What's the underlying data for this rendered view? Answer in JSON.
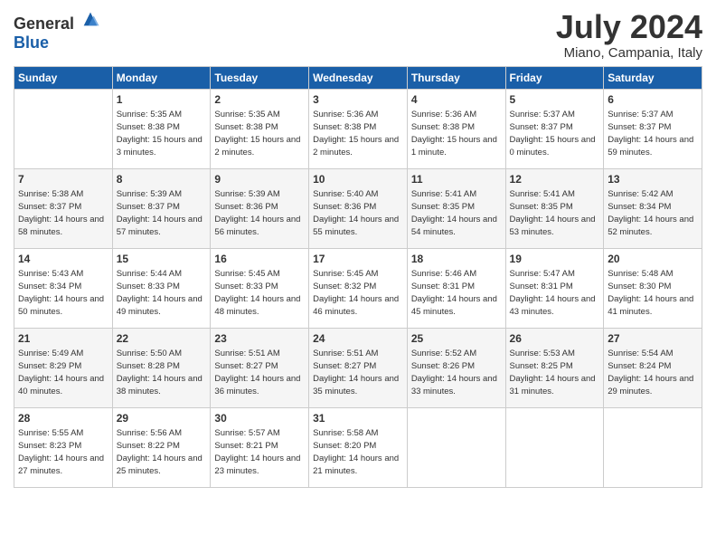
{
  "header": {
    "logo_general": "General",
    "logo_blue": "Blue",
    "title": "July 2024",
    "subtitle": "Miano, Campania, Italy"
  },
  "weekdays": [
    "Sunday",
    "Monday",
    "Tuesday",
    "Wednesday",
    "Thursday",
    "Friday",
    "Saturday"
  ],
  "weeks": [
    [
      {
        "day": "",
        "sunrise": "",
        "sunset": "",
        "daylight": ""
      },
      {
        "day": "1",
        "sunrise": "Sunrise: 5:35 AM",
        "sunset": "Sunset: 8:38 PM",
        "daylight": "Daylight: 15 hours and 3 minutes."
      },
      {
        "day": "2",
        "sunrise": "Sunrise: 5:35 AM",
        "sunset": "Sunset: 8:38 PM",
        "daylight": "Daylight: 15 hours and 2 minutes."
      },
      {
        "day": "3",
        "sunrise": "Sunrise: 5:36 AM",
        "sunset": "Sunset: 8:38 PM",
        "daylight": "Daylight: 15 hours and 2 minutes."
      },
      {
        "day": "4",
        "sunrise": "Sunrise: 5:36 AM",
        "sunset": "Sunset: 8:38 PM",
        "daylight": "Daylight: 15 hours and 1 minute."
      },
      {
        "day": "5",
        "sunrise": "Sunrise: 5:37 AM",
        "sunset": "Sunset: 8:37 PM",
        "daylight": "Daylight: 15 hours and 0 minutes."
      },
      {
        "day": "6",
        "sunrise": "Sunrise: 5:37 AM",
        "sunset": "Sunset: 8:37 PM",
        "daylight": "Daylight: 14 hours and 59 minutes."
      }
    ],
    [
      {
        "day": "7",
        "sunrise": "Sunrise: 5:38 AM",
        "sunset": "Sunset: 8:37 PM",
        "daylight": "Daylight: 14 hours and 58 minutes."
      },
      {
        "day": "8",
        "sunrise": "Sunrise: 5:39 AM",
        "sunset": "Sunset: 8:37 PM",
        "daylight": "Daylight: 14 hours and 57 minutes."
      },
      {
        "day": "9",
        "sunrise": "Sunrise: 5:39 AM",
        "sunset": "Sunset: 8:36 PM",
        "daylight": "Daylight: 14 hours and 56 minutes."
      },
      {
        "day": "10",
        "sunrise": "Sunrise: 5:40 AM",
        "sunset": "Sunset: 8:36 PM",
        "daylight": "Daylight: 14 hours and 55 minutes."
      },
      {
        "day": "11",
        "sunrise": "Sunrise: 5:41 AM",
        "sunset": "Sunset: 8:35 PM",
        "daylight": "Daylight: 14 hours and 54 minutes."
      },
      {
        "day": "12",
        "sunrise": "Sunrise: 5:41 AM",
        "sunset": "Sunset: 8:35 PM",
        "daylight": "Daylight: 14 hours and 53 minutes."
      },
      {
        "day": "13",
        "sunrise": "Sunrise: 5:42 AM",
        "sunset": "Sunset: 8:34 PM",
        "daylight": "Daylight: 14 hours and 52 minutes."
      }
    ],
    [
      {
        "day": "14",
        "sunrise": "Sunrise: 5:43 AM",
        "sunset": "Sunset: 8:34 PM",
        "daylight": "Daylight: 14 hours and 50 minutes."
      },
      {
        "day": "15",
        "sunrise": "Sunrise: 5:44 AM",
        "sunset": "Sunset: 8:33 PM",
        "daylight": "Daylight: 14 hours and 49 minutes."
      },
      {
        "day": "16",
        "sunrise": "Sunrise: 5:45 AM",
        "sunset": "Sunset: 8:33 PM",
        "daylight": "Daylight: 14 hours and 48 minutes."
      },
      {
        "day": "17",
        "sunrise": "Sunrise: 5:45 AM",
        "sunset": "Sunset: 8:32 PM",
        "daylight": "Daylight: 14 hours and 46 minutes."
      },
      {
        "day": "18",
        "sunrise": "Sunrise: 5:46 AM",
        "sunset": "Sunset: 8:31 PM",
        "daylight": "Daylight: 14 hours and 45 minutes."
      },
      {
        "day": "19",
        "sunrise": "Sunrise: 5:47 AM",
        "sunset": "Sunset: 8:31 PM",
        "daylight": "Daylight: 14 hours and 43 minutes."
      },
      {
        "day": "20",
        "sunrise": "Sunrise: 5:48 AM",
        "sunset": "Sunset: 8:30 PM",
        "daylight": "Daylight: 14 hours and 41 minutes."
      }
    ],
    [
      {
        "day": "21",
        "sunrise": "Sunrise: 5:49 AM",
        "sunset": "Sunset: 8:29 PM",
        "daylight": "Daylight: 14 hours and 40 minutes."
      },
      {
        "day": "22",
        "sunrise": "Sunrise: 5:50 AM",
        "sunset": "Sunset: 8:28 PM",
        "daylight": "Daylight: 14 hours and 38 minutes."
      },
      {
        "day": "23",
        "sunrise": "Sunrise: 5:51 AM",
        "sunset": "Sunset: 8:27 PM",
        "daylight": "Daylight: 14 hours and 36 minutes."
      },
      {
        "day": "24",
        "sunrise": "Sunrise: 5:51 AM",
        "sunset": "Sunset: 8:27 PM",
        "daylight": "Daylight: 14 hours and 35 minutes."
      },
      {
        "day": "25",
        "sunrise": "Sunrise: 5:52 AM",
        "sunset": "Sunset: 8:26 PM",
        "daylight": "Daylight: 14 hours and 33 minutes."
      },
      {
        "day": "26",
        "sunrise": "Sunrise: 5:53 AM",
        "sunset": "Sunset: 8:25 PM",
        "daylight": "Daylight: 14 hours and 31 minutes."
      },
      {
        "day": "27",
        "sunrise": "Sunrise: 5:54 AM",
        "sunset": "Sunset: 8:24 PM",
        "daylight": "Daylight: 14 hours and 29 minutes."
      }
    ],
    [
      {
        "day": "28",
        "sunrise": "Sunrise: 5:55 AM",
        "sunset": "Sunset: 8:23 PM",
        "daylight": "Daylight: 14 hours and 27 minutes."
      },
      {
        "day": "29",
        "sunrise": "Sunrise: 5:56 AM",
        "sunset": "Sunset: 8:22 PM",
        "daylight": "Daylight: 14 hours and 25 minutes."
      },
      {
        "day": "30",
        "sunrise": "Sunrise: 5:57 AM",
        "sunset": "Sunset: 8:21 PM",
        "daylight": "Daylight: 14 hours and 23 minutes."
      },
      {
        "day": "31",
        "sunrise": "Sunrise: 5:58 AM",
        "sunset": "Sunset: 8:20 PM",
        "daylight": "Daylight: 14 hours and 21 minutes."
      },
      {
        "day": "",
        "sunrise": "",
        "sunset": "",
        "daylight": ""
      },
      {
        "day": "",
        "sunrise": "",
        "sunset": "",
        "daylight": ""
      },
      {
        "day": "",
        "sunrise": "",
        "sunset": "",
        "daylight": ""
      }
    ]
  ]
}
